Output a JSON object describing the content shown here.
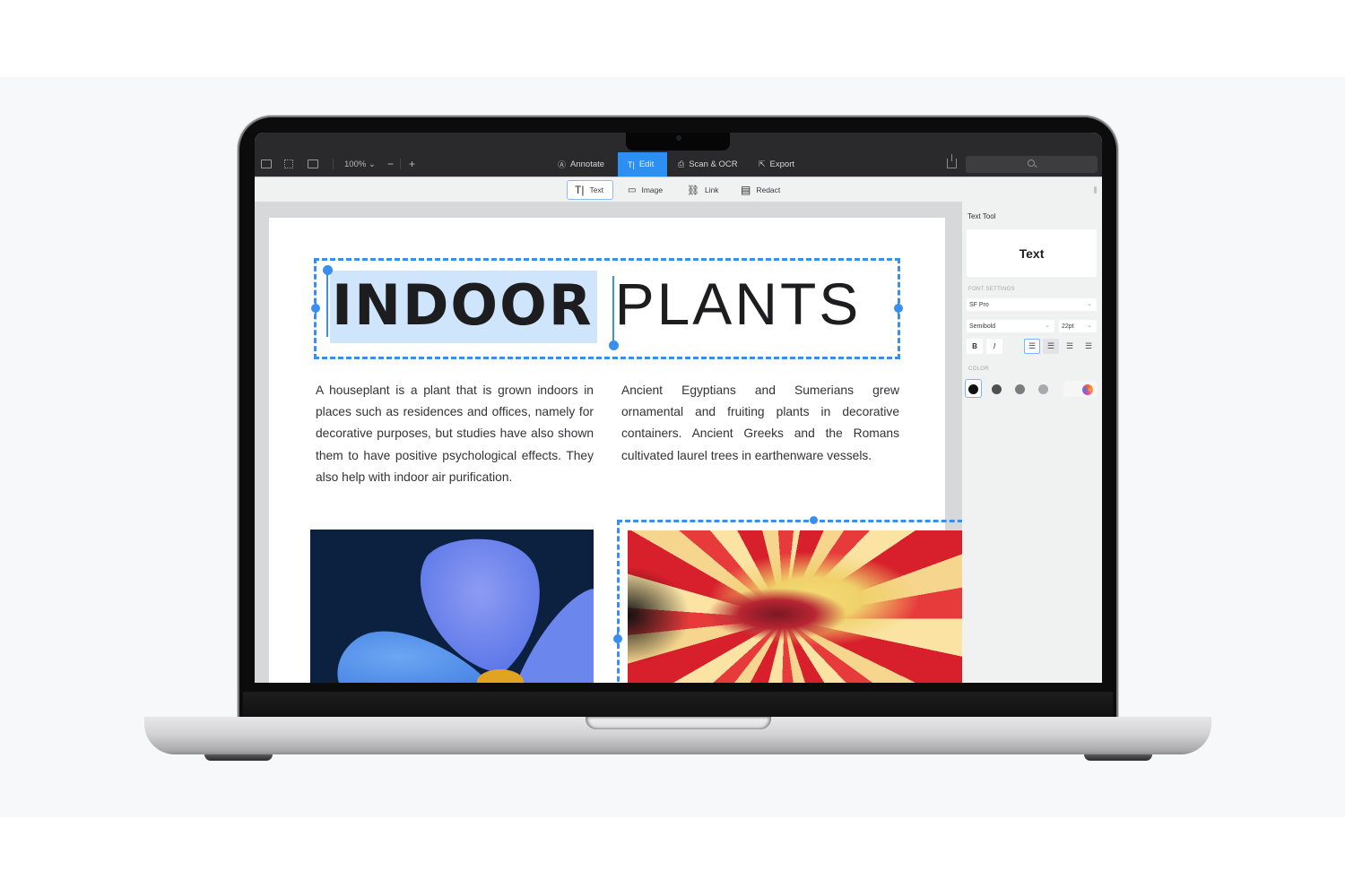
{
  "toolbar": {
    "zoom_level": "100%",
    "zoom_chevron": "⌄",
    "zoom_out": "−",
    "zoom_in": "+",
    "view_icons": [
      "sidebar-icon",
      "grid-icon",
      "page-layout-icon"
    ],
    "modes": [
      {
        "label": "Annotate",
        "icon": "Ⓐ",
        "active": false
      },
      {
        "label": "Edit",
        "icon": "T|",
        "active": true
      },
      {
        "label": "Scan & OCR",
        "icon": "⎙",
        "active": false
      },
      {
        "label": "Export",
        "icon": "⇱",
        "active": false
      }
    ],
    "accent_color": "#2C8FF4"
  },
  "edit_tools": [
    {
      "label": "Text",
      "icon": "T|",
      "active": true
    },
    {
      "label": "Image",
      "icon": "🖼",
      "active": false
    },
    {
      "label": "Link",
      "icon": "🔗",
      "active": false
    },
    {
      "label": "Redact",
      "icon": "▤",
      "active": false
    }
  ],
  "document": {
    "title_bold": "INDOOR",
    "title_light": "PLANTS",
    "paragraph_left": "A houseplant is a plant that is grown indoors in places such as residences and offices, namely for decorative purposes, but studies have also shown them to have positive psychological effects. They also help with indoor air purification.",
    "paragraph_right": "Ancient Egyptians and Sumerians grew ornamental and fruiting plants in decorative containers. Ancient Greeks and the Romans cultivated laurel trees in earthenware vessels.",
    "images": [
      "blue-flower-photo",
      "red-dahlia-photo"
    ],
    "selection_color": "#3A8EF0"
  },
  "panel": {
    "title": "Text Tool",
    "preview_text": "Text",
    "font_settings_label": "FONT SETTINGS",
    "font_family": "SF Pro",
    "font_weight": "Semibold",
    "font_size": "22pt",
    "bold_label": "B",
    "italic_label": "I",
    "alignments": [
      "align-left",
      "align-center",
      "justify",
      "align-right"
    ],
    "color_label": "COLOR",
    "swatches": [
      "#111111",
      "#505052",
      "#7c7c7e",
      "#a9a9ab"
    ],
    "selected_swatch": "#111111"
  }
}
